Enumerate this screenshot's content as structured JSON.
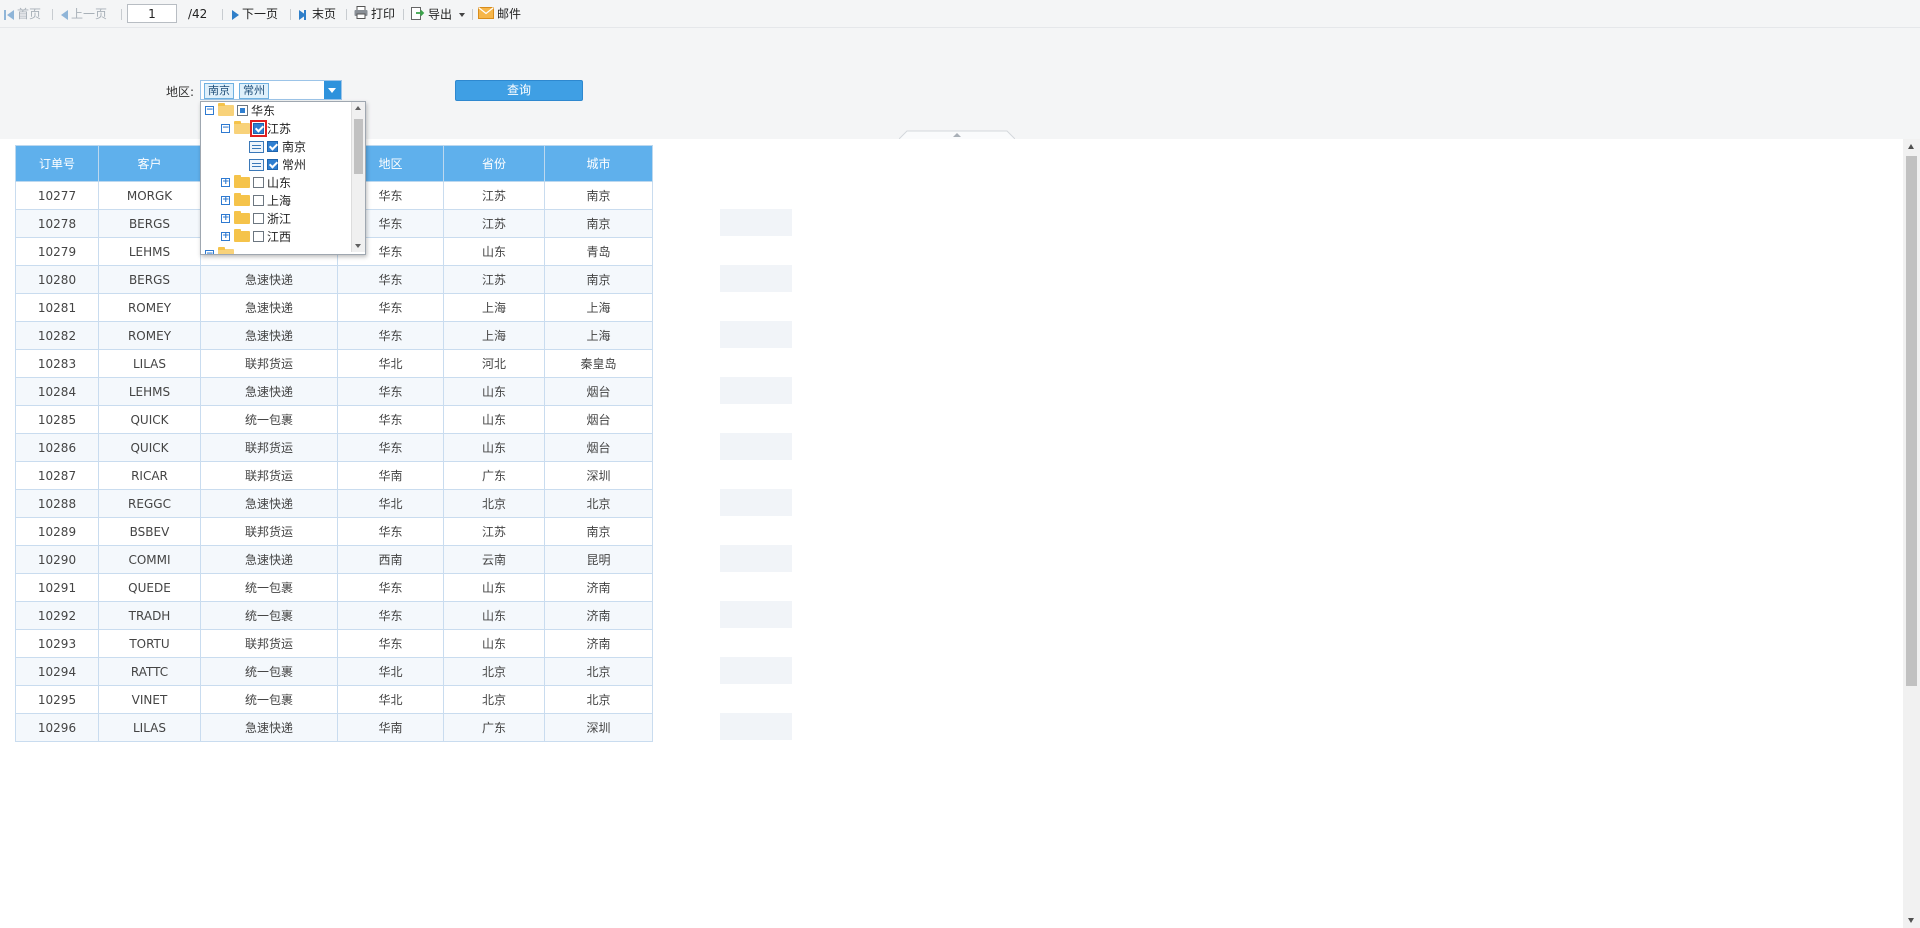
{
  "toolbar": {
    "first_page": "首页",
    "prev_page": "上一页",
    "current_page": "1",
    "total_pages": "/42",
    "next_page": "下一页",
    "last_page": "末页",
    "print": "打印",
    "export": "导出",
    "mail": "邮件"
  },
  "filter": {
    "region_label": "地区:",
    "selected_tags": [
      "南京",
      "常州"
    ],
    "query_button": "查询"
  },
  "tree": {
    "nodes": [
      {
        "label": "华东",
        "level": 0,
        "expanded": true,
        "state": "partial"
      },
      {
        "label": "江苏",
        "level": 1,
        "expanded": true,
        "state": "checked"
      },
      {
        "label": "南京",
        "level": 2,
        "leaf": true,
        "state": "checked"
      },
      {
        "label": "常州",
        "level": 2,
        "leaf": true,
        "state": "checked"
      },
      {
        "label": "山东",
        "level": 1,
        "expanded": false,
        "state": "unchecked"
      },
      {
        "label": "上海",
        "level": 1,
        "expanded": false,
        "state": "unchecked"
      },
      {
        "label": "浙江",
        "level": 1,
        "expanded": false,
        "state": "unchecked"
      },
      {
        "label": "江西",
        "level": 1,
        "expanded": false,
        "state": "unchecked"
      }
    ]
  },
  "table": {
    "headers": [
      "订单号",
      "客户",
      "",
      "地区",
      "省份",
      "城市"
    ],
    "rows": [
      [
        "10277",
        "MORGK",
        "",
        "华东",
        "江苏",
        "南京"
      ],
      [
        "10278",
        "BERGS",
        "",
        "华东",
        "江苏",
        "南京"
      ],
      [
        "10279",
        "LEHMS",
        "",
        "华东",
        "山东",
        "青岛"
      ],
      [
        "10280",
        "BERGS",
        "急速快递",
        "华东",
        "江苏",
        "南京"
      ],
      [
        "10281",
        "ROMEY",
        "急速快递",
        "华东",
        "上海",
        "上海"
      ],
      [
        "10282",
        "ROMEY",
        "急速快递",
        "华东",
        "上海",
        "上海"
      ],
      [
        "10283",
        "LILAS",
        "联邦货运",
        "华北",
        "河北",
        "秦皇岛"
      ],
      [
        "10284",
        "LEHMS",
        "急速快递",
        "华东",
        "山东",
        "烟台"
      ],
      [
        "10285",
        "QUICK",
        "统一包裹",
        "华东",
        "山东",
        "烟台"
      ],
      [
        "10286",
        "QUICK",
        "联邦货运",
        "华东",
        "山东",
        "烟台"
      ],
      [
        "10287",
        "RICAR",
        "联邦货运",
        "华南",
        "广东",
        "深圳"
      ],
      [
        "10288",
        "REGGC",
        "急速快递",
        "华北",
        "北京",
        "北京"
      ],
      [
        "10289",
        "BSBEV",
        "联邦货运",
        "华东",
        "江苏",
        "南京"
      ],
      [
        "10290",
        "COMMI",
        "急速快递",
        "西南",
        "云南",
        "昆明"
      ],
      [
        "10291",
        "QUEDE",
        "统一包裹",
        "华东",
        "山东",
        "济南"
      ],
      [
        "10292",
        "TRADH",
        "统一包裹",
        "华东",
        "山东",
        "济南"
      ],
      [
        "10293",
        "TORTU",
        "联邦货运",
        "华东",
        "山东",
        "济南"
      ],
      [
        "10294",
        "RATTC",
        "统一包裹",
        "华北",
        "北京",
        "北京"
      ],
      [
        "10295",
        "VINET",
        "统一包裹",
        "华北",
        "北京",
        "北京"
      ],
      [
        "10296",
        "LILAS",
        "急速快递",
        "华南",
        "广东",
        "深圳"
      ]
    ]
  },
  "colors": {
    "header_bg": "#5fb0ec",
    "accent": "#2e92dc",
    "checkbox_highlight": "#e02020"
  }
}
